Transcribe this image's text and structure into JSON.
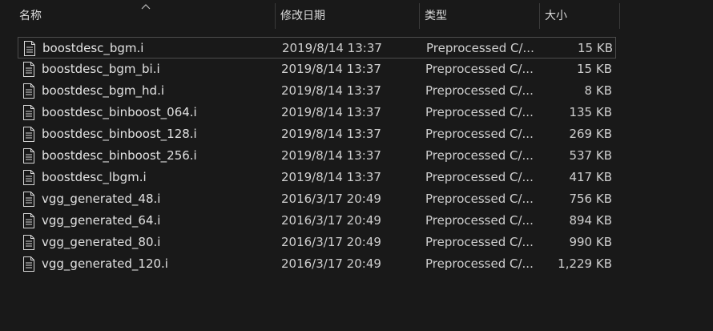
{
  "columns": {
    "name": "名称",
    "modified": "修改日期",
    "type": "类型",
    "size": "大小"
  },
  "files": [
    {
      "name": "boostdesc_bgm.i",
      "modified": "2019/8/14 13:37",
      "type": "Preprocessed C/...",
      "size": "15 KB",
      "selected": true
    },
    {
      "name": "boostdesc_bgm_bi.i",
      "modified": "2019/8/14 13:37",
      "type": "Preprocessed C/...",
      "size": "15 KB"
    },
    {
      "name": "boostdesc_bgm_hd.i",
      "modified": "2019/8/14 13:37",
      "type": "Preprocessed C/...",
      "size": "8 KB"
    },
    {
      "name": "boostdesc_binboost_064.i",
      "modified": "2019/8/14 13:37",
      "type": "Preprocessed C/...",
      "size": "135 KB"
    },
    {
      "name": "boostdesc_binboost_128.i",
      "modified": "2019/8/14 13:37",
      "type": "Preprocessed C/...",
      "size": "269 KB"
    },
    {
      "name": "boostdesc_binboost_256.i",
      "modified": "2019/8/14 13:37",
      "type": "Preprocessed C/...",
      "size": "537 KB"
    },
    {
      "name": "boostdesc_lbgm.i",
      "modified": "2019/8/14 13:37",
      "type": "Preprocessed C/...",
      "size": "417 KB"
    },
    {
      "name": "vgg_generated_48.i",
      "modified": "2016/3/17 20:49",
      "type": "Preprocessed C/...",
      "size": "756 KB"
    },
    {
      "name": "vgg_generated_64.i",
      "modified": "2016/3/17 20:49",
      "type": "Preprocessed C/...",
      "size": "894 KB"
    },
    {
      "name": "vgg_generated_80.i",
      "modified": "2016/3/17 20:49",
      "type": "Preprocessed C/...",
      "size": "990 KB"
    },
    {
      "name": "vgg_generated_120.i",
      "modified": "2016/3/17 20:49",
      "type": "Preprocessed C/...",
      "size": "1,229 KB"
    }
  ],
  "sort": {
    "column": "name",
    "direction": "ascending",
    "icon": "sort-up-chevron-icon"
  },
  "file_icon": "document-file-icon"
}
